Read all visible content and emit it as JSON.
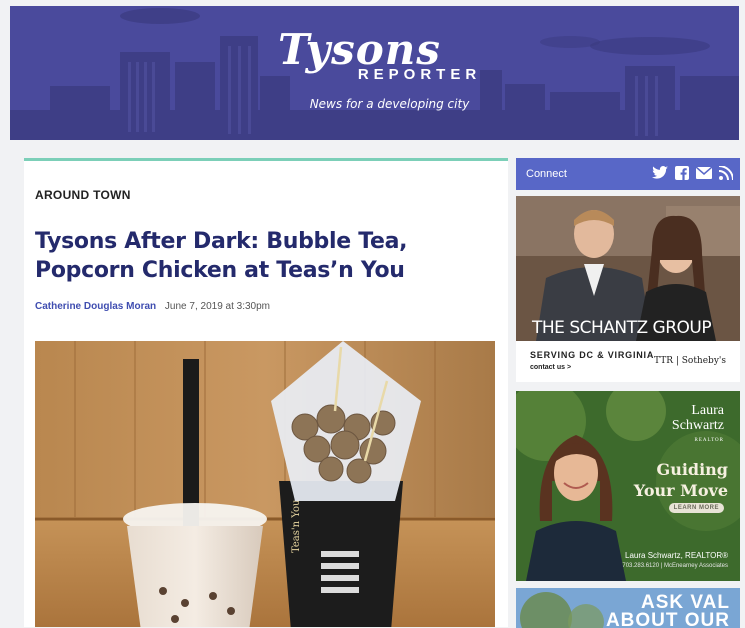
{
  "site": {
    "logo_script": "Tysons",
    "logo_word": "REPORTER",
    "tagline": "News for a developing city"
  },
  "article": {
    "section": "AROUND TOWN",
    "headline": "Tysons After Dark: Bubble Tea, Popcorn Chicken at Teas’n You",
    "author": "Catherine Douglas Moran",
    "date": "June 7, 2019 at 3:30pm",
    "photo_cup_brand": "Teas'n You"
  },
  "sidebar": {
    "connect_label": "Connect",
    "connect_icons": [
      "twitter-icon",
      "facebook-icon",
      "email-icon",
      "rss-icon"
    ],
    "ad1": {
      "title": "THE SCHANTZ GROUP",
      "serving": "SERVING DC & VIRGINIA",
      "contact": "contact us >",
      "brand": "TTR | Sotheby's"
    },
    "ad2": {
      "logo_line1": "Laura",
      "logo_line2": "Schwartz",
      "logo_line3": "REALTOR",
      "headline_line1": "Guiding",
      "headline_line2": "Your Move",
      "button": "LEARN MORE",
      "name": "Laura Schwartz, REALTOR®",
      "phone": "703.283.6120 | McEnearney Associates"
    },
    "ad3": {
      "line1": "ASK VAL",
      "line2": "ABOUT OUR"
    }
  },
  "colors": {
    "header_bg": "#4a4a9c",
    "headline": "#242a6c",
    "author": "#3f4db0",
    "accent_rule": "#7ccfb8",
    "connect_bg": "#5867c7"
  }
}
